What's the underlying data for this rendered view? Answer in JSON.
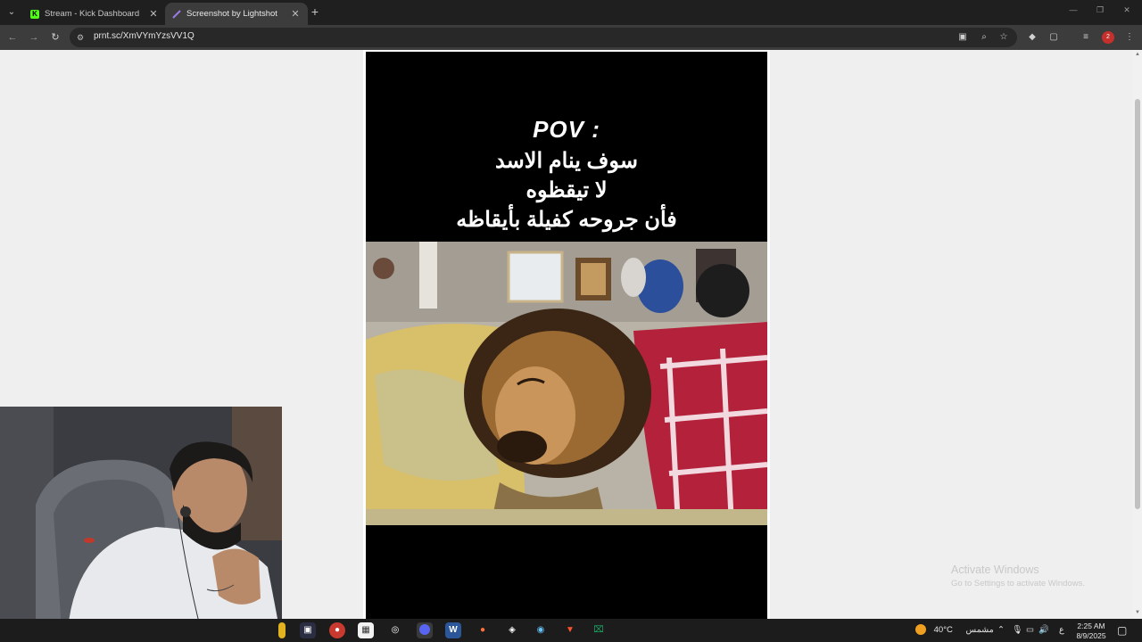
{
  "browser": {
    "tabs": [
      {
        "label": "Stream - Kick Dashboard",
        "favicon_color": "#53fc18",
        "active": false
      },
      {
        "label": "Screenshot by Lightshot",
        "favicon_color": "#8e6bd8",
        "active": true
      }
    ],
    "new_tab": "+",
    "url": "prnt.sc/XmVYmYzsVV1Q",
    "profile_badge": "2"
  },
  "content": {
    "caption_pov": "POV :",
    "caption_line1": "سوف ينام الاسد",
    "caption_line2": "لا تيقظوه",
    "caption_line3": "فأن جروحه كفيلة بأيقاظه",
    "photo_description_icon": "sleeping-lion-photo"
  },
  "watermark": {
    "title": "Activate Windows",
    "subtitle": "Go to Settings to activate Windows."
  },
  "taskbar": {
    "weather_temp": "40°C",
    "weather_text": "مشمس",
    "lang": "ع",
    "time": "2:25 AM",
    "date": "8/9/2025"
  },
  "colors": {
    "page_bg": "#efefef",
    "chrome_dark": "#1f1f1f",
    "toolbar": "#3c3c3c"
  }
}
